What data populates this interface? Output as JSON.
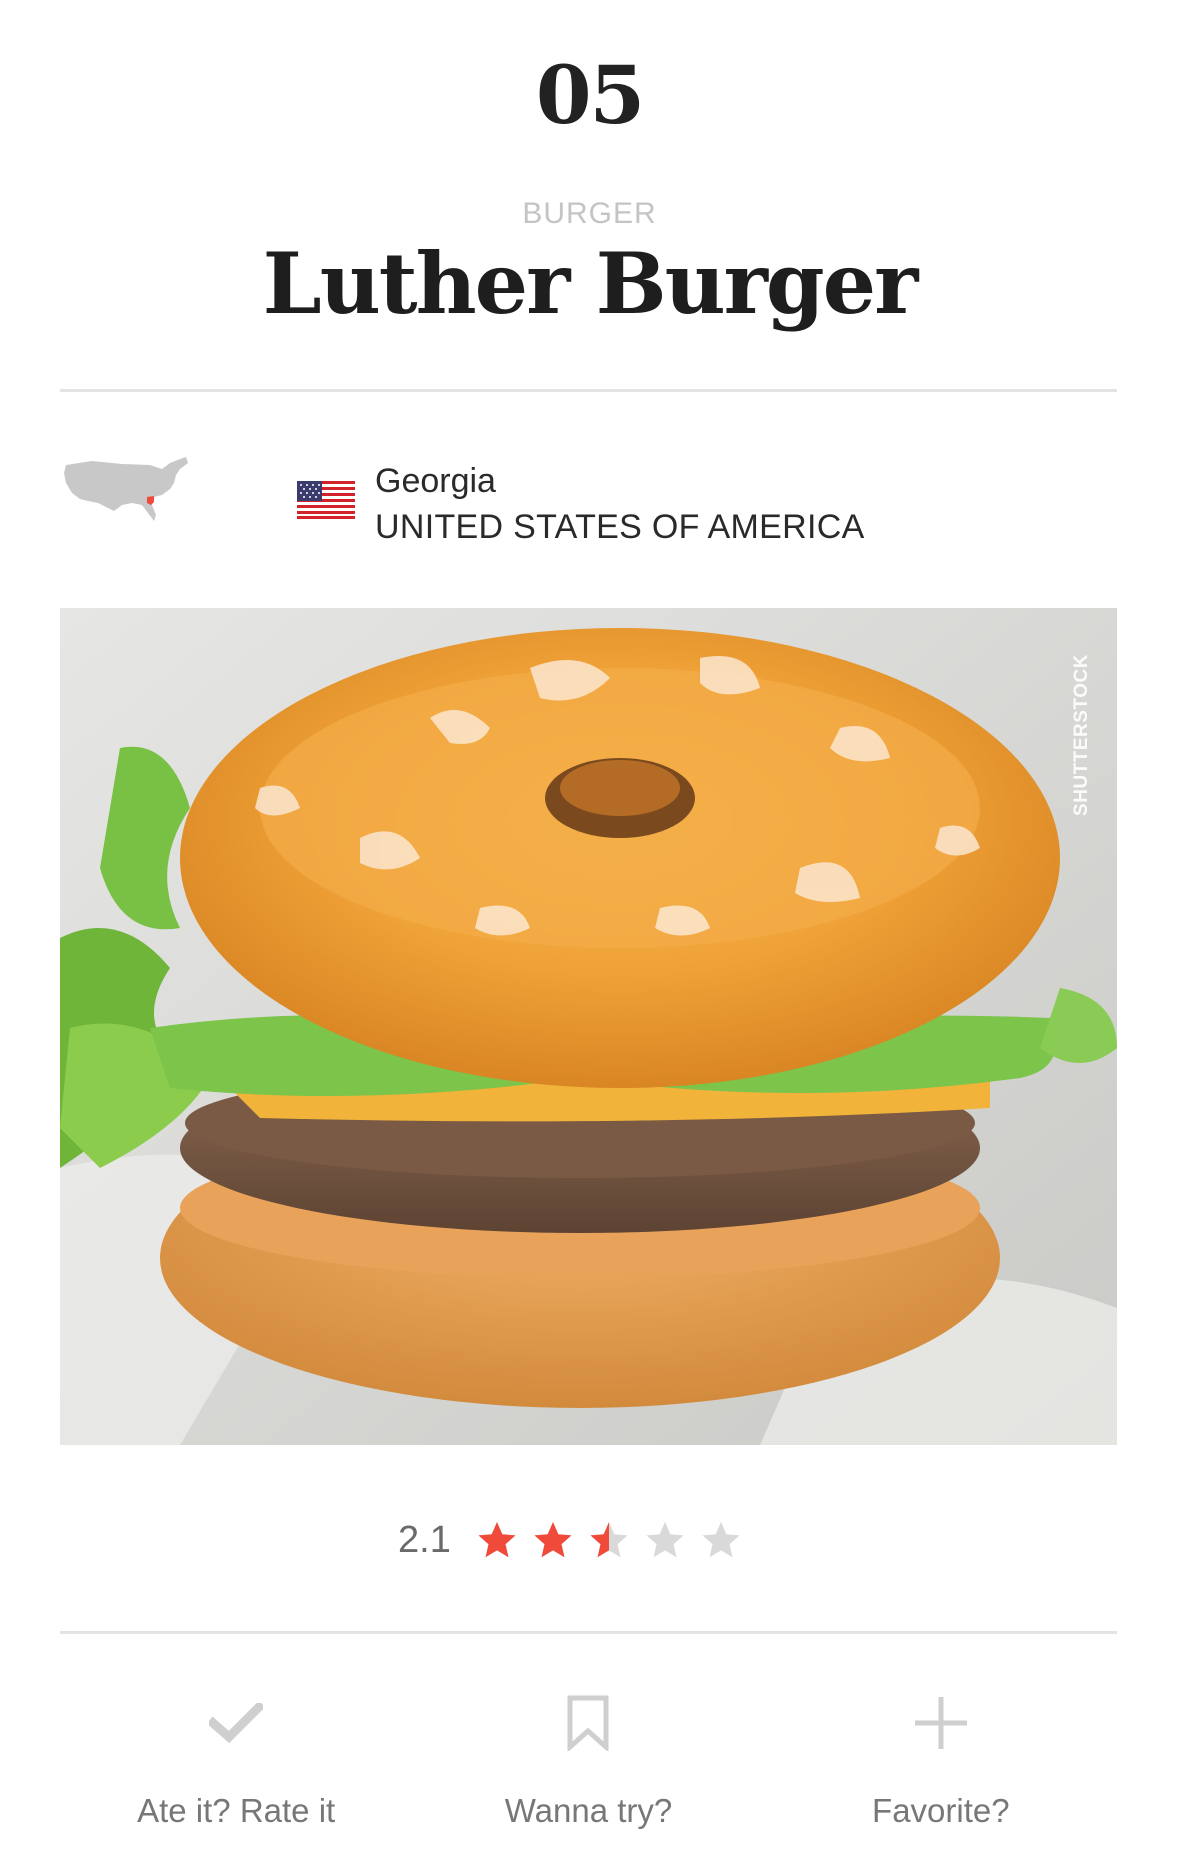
{
  "header": {
    "rank": "05",
    "category": "BURGER",
    "title": "Luther Burger"
  },
  "location": {
    "region": "Georgia",
    "country": "UNITED STATES OF AMERICA",
    "map_icon": "usa-map-icon",
    "flag_icon": "us-flag-icon"
  },
  "photo": {
    "credit": "SHUTTERSTOCK"
  },
  "rating": {
    "value": "2.1",
    "stars_filled": 2.5,
    "stars_total": 5,
    "color_filled": "#f04a3a",
    "color_empty": "#d9d9d9"
  },
  "actions": [
    {
      "label": "Ate it? Rate it",
      "icon": "check-icon"
    },
    {
      "label": "Wanna try?",
      "icon": "bookmark-icon"
    },
    {
      "label": "Favorite?",
      "icon": "plus-icon"
    }
  ],
  "colors": {
    "accent": "#f04a3a",
    "icon_gray": "#d0d0d0",
    "divider": "#e3e3e3"
  }
}
